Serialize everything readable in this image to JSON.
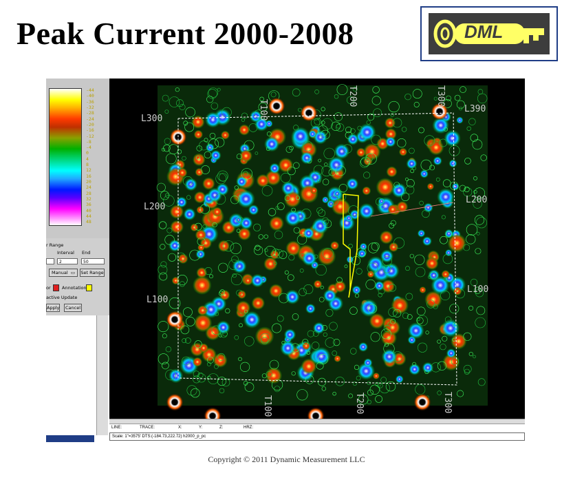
{
  "slide": {
    "title": "Peak Current 2000-2008",
    "copyright": "Copyright © 2011  Dynamic Measurement LLC"
  },
  "logo": {
    "text": "DML",
    "key_color": "#ffff66",
    "bg_color": "#3d3d3d"
  },
  "colorbar": {
    "ticks": [
      "-44",
      "-40",
      "-36",
      "-32",
      "-28",
      "-24",
      "-20",
      "-16",
      "-12",
      "-8",
      "-4",
      "0",
      "4",
      "8",
      "12",
      "16",
      "20",
      "24",
      "28",
      "32",
      "36",
      "40",
      "44",
      "48"
    ]
  },
  "controls": {
    "range_label": "r Range",
    "interval_label": "Interval",
    "end_label": "End",
    "start_value": "",
    "interval_value": "2",
    "end_value": "50",
    "mode_option": "Manual",
    "set_range_label": "Set Range",
    "color_label": "or",
    "annotation_label": "Annotation",
    "interactive_update_label": "active Update",
    "apply_label": "Apply",
    "cancel_label": "Cancel",
    "color_swatch": "#e02020",
    "annotation_swatch": "#ffff00"
  },
  "map": {
    "line_labels": {
      "t100_top": "T100",
      "t200_top": "T200",
      "t300_top": "T300",
      "l300_left": "L300",
      "l390_right": "L390",
      "l200_left": "L200",
      "l200_right": "L200",
      "l100_left": "L100",
      "l100_right": "L100",
      "t100_bottom": "T100",
      "t200_bottom": "T200",
      "t300_bottom": "T300"
    },
    "boundary_color": "#ffffff",
    "polygon_color": "#ffff00"
  },
  "status": {
    "line": "LINE:",
    "trace": "TRACE:",
    "x": "X:",
    "y": "Y:",
    "z": "Z:",
    "hrz": "HRZ:",
    "scale_text": "Scale: 1\"=3575' DTS:(-184.73,222.72) h2000_p_pc"
  }
}
